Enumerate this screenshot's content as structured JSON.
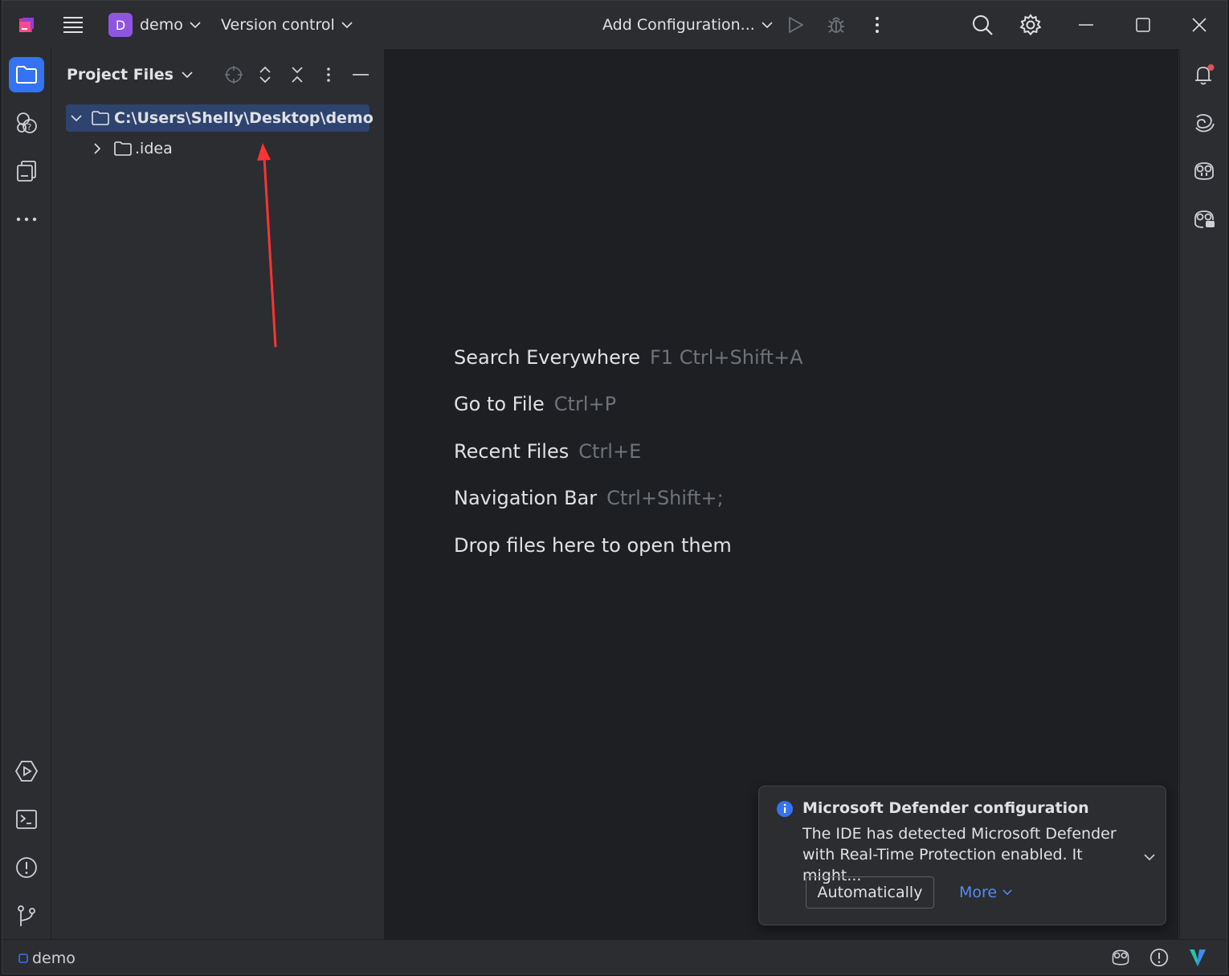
{
  "titlebar": {
    "project_badge": "D",
    "project_name": "demo",
    "vcs_label": "Version control",
    "run_config_label": "Add Configuration..."
  },
  "project_panel": {
    "title": "Project Files",
    "root_path": "C:\\Users\\Shelly\\Desktop\\demo",
    "child_folder": ".idea"
  },
  "editor_hints": [
    {
      "label": "Search Everywhere",
      "shortcut": "F1 Ctrl+Shift+A"
    },
    {
      "label": "Go to File",
      "shortcut": "Ctrl+P"
    },
    {
      "label": "Recent Files",
      "shortcut": "Ctrl+E"
    },
    {
      "label": "Navigation Bar",
      "shortcut": "Ctrl+Shift+;"
    },
    {
      "label": "Drop files here to open them",
      "shortcut": ""
    }
  ],
  "notification": {
    "title": "Microsoft Defender configuration",
    "line1": "The IDE has detected Microsoft Defender",
    "line2": "with Real-Time Protection enabled. It might...",
    "primary_action": "Automatically",
    "secondary_action": "More"
  },
  "statusbar": {
    "project_name": "demo"
  },
  "colors": {
    "accent": "#3574f0",
    "badge": "#9055e0",
    "link": "#548af7",
    "selection": "#2e436e",
    "annotation_arrow": "#ff3333",
    "notification_badge": "#e05555"
  },
  "icons": [
    "app-logo-icon",
    "hamburger-menu-icon",
    "chevron-down-icon",
    "run-icon",
    "debug-icon",
    "more-vertical-icon",
    "search-icon",
    "settings-icon",
    "minimize-icon",
    "maximize-icon",
    "close-icon",
    "folder-icon",
    "learn-icon",
    "structure-icon",
    "more-horizontal-icon",
    "services-icon",
    "terminal-icon",
    "problems-icon",
    "git-icon",
    "notifications-icon",
    "ai-assistant-icon",
    "copilot-icon",
    "copilot-chat-icon",
    "locate-icon",
    "expand-all-icon",
    "collapse-all-icon",
    "hide-icon",
    "info-icon",
    "chevron-right-icon"
  ]
}
